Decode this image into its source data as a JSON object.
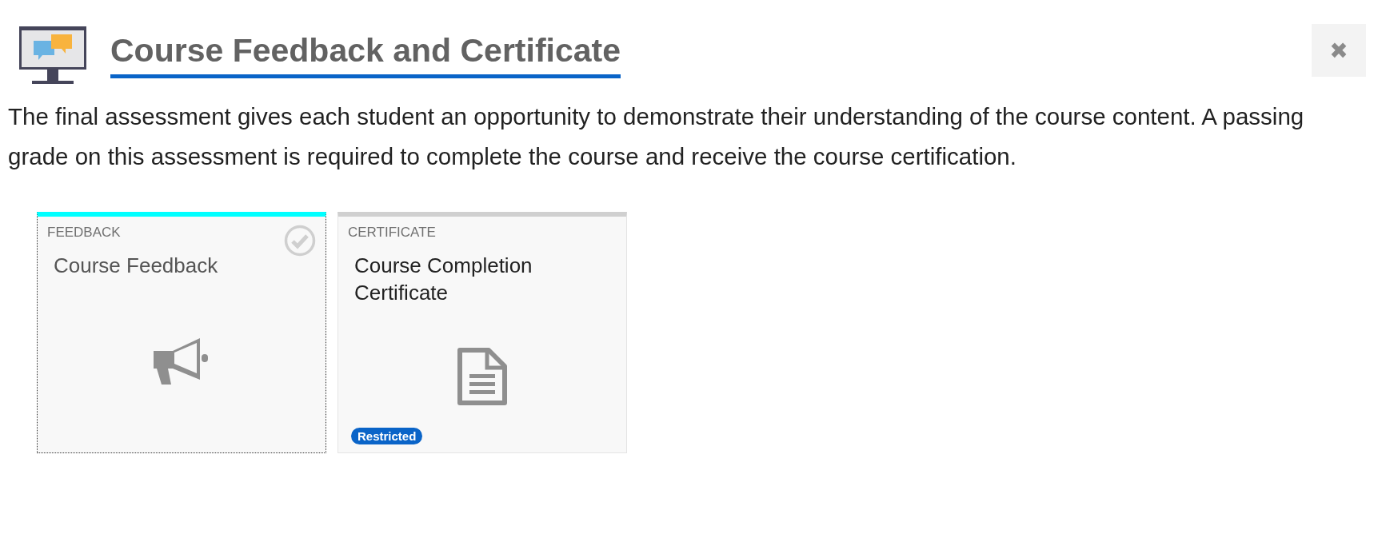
{
  "header": {
    "title": "Course Feedback and Certificate",
    "close_label": "✖"
  },
  "description": "The final assessment gives each student an opportunity to demonstrate their understanding of the course content. A passing grade on this assessment is required to complete the course and receive the course certification.",
  "cards": [
    {
      "kind": "feedback",
      "category": "FEEDBACK",
      "title": "Course Feedback",
      "completed": true,
      "focused": true,
      "color": "#00ffff"
    },
    {
      "kind": "certificate",
      "category": "CERTIFICATE",
      "title": "Course Completion Certificate",
      "completed": false,
      "focused": false,
      "color": "#d0d0d0",
      "badge": "Restricted"
    }
  ]
}
